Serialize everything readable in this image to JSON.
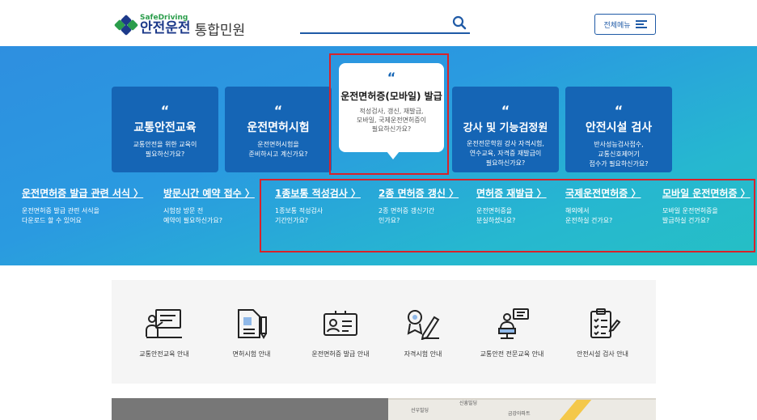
{
  "header": {
    "logo_sub": "SafeDriving",
    "logo_main": "안전운전",
    "logo_main2": "통합민원",
    "menu_label": "전체메뉴"
  },
  "cards": [
    {
      "title": "교통안전교육",
      "desc": "교통안전을 위한 교육이\n필요하신가요?"
    },
    {
      "title": "운전면허시험",
      "desc": "운전면허시험을\n준비하시고 계신가요?"
    },
    {
      "title": "강사 및 기능검정원",
      "desc": "운전전문학원 강사 자격시험,\n연수교육, 자격증 재발급이\n필요하신가요?"
    },
    {
      "title": "안전시설 검사",
      "desc": "반사성능검사접수,\n교통신호제어기\n접수가 필요하신가요?"
    }
  ],
  "featured": {
    "title": "운전면허증(모바일) 발급",
    "desc": "적성검사, 갱신, 재발급,\n모바일, 국제운전면허증이\n필요하신가요?"
  },
  "quote_mark": "“",
  "links": [
    {
      "title": "운전면허증 발급 관련 서식 〉",
      "desc": "운전면허증 발급 관련 서식을\n다운로드 할 수 있어요"
    },
    {
      "title": "방문시간 예약 접수 〉",
      "desc": "시험장 방문 전\n예약이 필요하신가요?"
    },
    {
      "title": "1종보통 적성검사 〉",
      "desc": "1종보통 적성검사\n기간인가요?"
    },
    {
      "title": "2종 면허증 갱신 〉",
      "desc": "2종 면허증 갱신기간\n인가요?"
    },
    {
      "title": "면허증 재발급 〉",
      "desc": "운전면허증을\n분실하셨나요?"
    },
    {
      "title": "국제운전면허증 〉",
      "desc": "해외에서\n운전하실 건가요?"
    },
    {
      "title": "모바일 운전면허증 〉",
      "desc": "모바일 운전면허증을\n발급하실 건가요?"
    }
  ],
  "services": [
    {
      "label": "교통안전교육 안내",
      "icon": "presentation-icon"
    },
    {
      "label": "면허시험 안내",
      "icon": "document-pen-icon"
    },
    {
      "label": "운전면허증 발급 안내",
      "icon": "id-card-icon"
    },
    {
      "label": "자격시험 안내",
      "icon": "certificate-icon"
    },
    {
      "label": "교통안전 전문교육 안내",
      "icon": "lecturer-icon"
    },
    {
      "label": "안전시설 검사 안내",
      "icon": "checklist-icon"
    }
  ],
  "map_labels": [
    "선우빌딩",
    "신흥빌딩",
    "금강아파트"
  ],
  "colors": {
    "brand_blue": "#1565b5",
    "highlight_red": "#d8222a",
    "accent": "#1f5aa6"
  }
}
